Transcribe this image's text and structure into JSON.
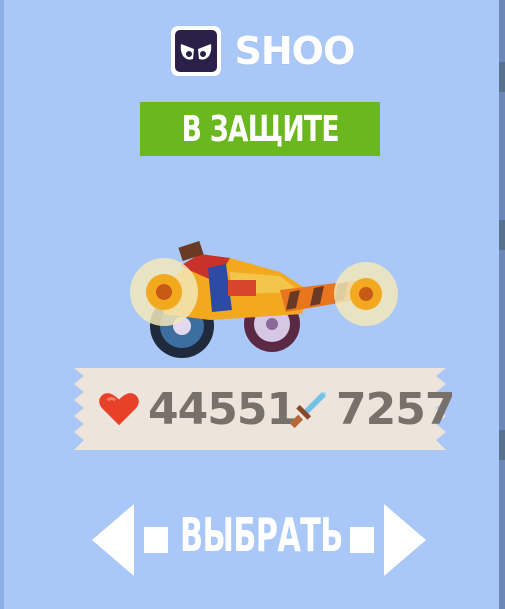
{
  "player": {
    "avatar_icon": "angry-eyes-icon",
    "name": "SHOO"
  },
  "status": {
    "label": "В ЗАЩИТЕ",
    "color": "#6ab71e"
  },
  "vehicle": {
    "icon": "battle-car-with-saws"
  },
  "stats": {
    "health": {
      "icon": "heart-icon",
      "value": "44551",
      "color": "#e8412a"
    },
    "attack": {
      "icon": "sword-icon",
      "value": "7257",
      "color": "#72c2e6"
    }
  },
  "select": {
    "label": "ВЫБРАТЬ",
    "prev_icon": "arrow-left-icon",
    "next_icon": "arrow-right-icon"
  },
  "colors": {
    "background": "#a9c7f7",
    "panel": "#ede4dc",
    "stat_text": "#78706a"
  }
}
